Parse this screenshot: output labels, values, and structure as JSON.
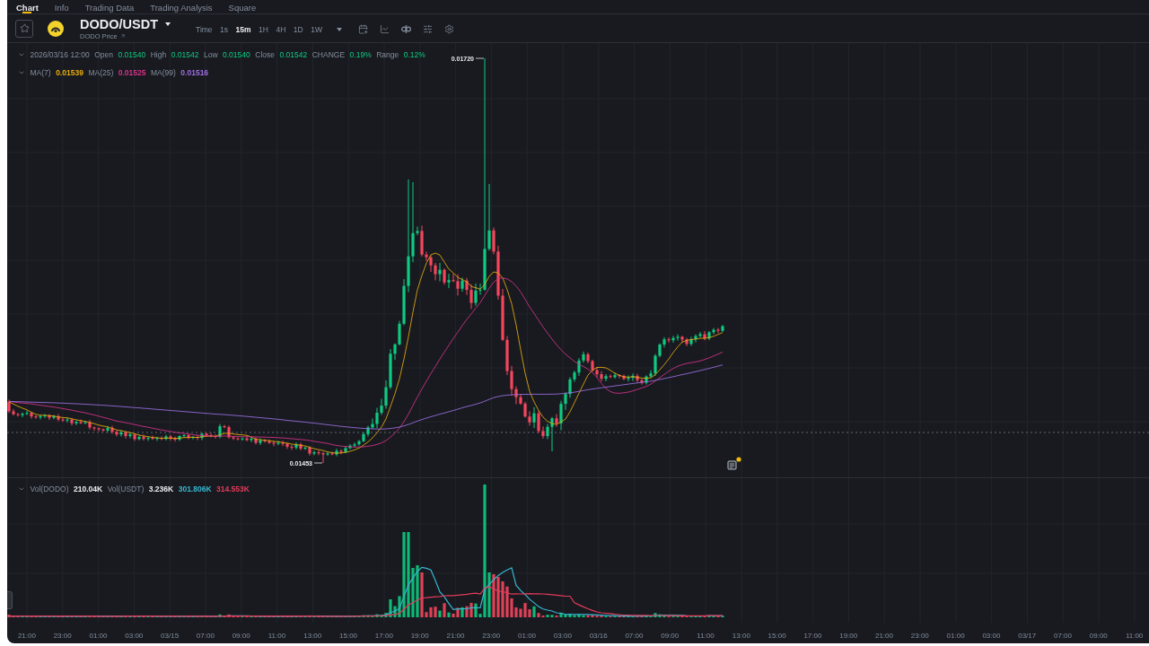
{
  "tabs": [
    {
      "label": "Chart",
      "selected": true
    },
    {
      "label": "Info",
      "selected": false
    },
    {
      "label": "Trading Data",
      "selected": false
    },
    {
      "label": "Trading Analysis",
      "selected": false
    },
    {
      "label": "Square",
      "selected": false
    }
  ],
  "symbol": {
    "pair": "DODO/USDT",
    "subtitle": "DODO Price"
  },
  "intervals": [
    {
      "label": "Time",
      "selected": false
    },
    {
      "label": "1s",
      "selected": false
    },
    {
      "label": "15m",
      "selected": true
    },
    {
      "label": "1H",
      "selected": false
    },
    {
      "label": "4H",
      "selected": false
    },
    {
      "label": "1D",
      "selected": false
    },
    {
      "label": "1W",
      "selected": false
    }
  ],
  "ohlc_legend": {
    "datetime": "2026/03/16 12:00",
    "rising": true,
    "fields": [
      {
        "label": "Open",
        "value": "0.01540"
      },
      {
        "label": "High",
        "value": "0.01542"
      },
      {
        "label": "Low",
        "value": "0.01540"
      },
      {
        "label": "Close",
        "value": "0.01542"
      },
      {
        "label": "CHANGE",
        "value": "0.19%"
      },
      {
        "label": "Range",
        "value": "0.12%"
      }
    ]
  },
  "ma_legend": [
    {
      "label": "MA(7)",
      "value": "0.01539",
      "color": "#e8ac0c"
    },
    {
      "label": "MA(25)",
      "value": "0.01525",
      "color": "#d6338a"
    },
    {
      "label": "MA(99)",
      "value": "0.01516",
      "color": "#9d6ee0"
    }
  ],
  "price_chart": {
    "high_label": "0.01720",
    "low_label": "0.01453"
  },
  "volume_legend": [
    {
      "label": "Vol(DODO)",
      "values": [
        {
          "text": "210.04K",
          "color": "#eaecef"
        }
      ]
    },
    {
      "label": "Vol(USDT)",
      "values": [
        {
          "text": "3.236K",
          "color": "#eaecef"
        },
        {
          "text": "301.806K",
          "color": "#38b6d0"
        },
        {
          "text": "314.553K",
          "color": "#e23b5a"
        }
      ]
    }
  ],
  "time_axis": [
    "21:00",
    "23:00",
    "01:00",
    "03:00",
    "03/15",
    "07:00",
    "09:00",
    "11:00",
    "13:00",
    "15:00",
    "17:00",
    "19:00",
    "21:00",
    "23:00",
    "01:00",
    "03:00",
    "03/16",
    "07:00",
    "09:00",
    "11:00",
    "13:00",
    "15:00",
    "17:00",
    "19:00",
    "21:00",
    "23:00",
    "01:00",
    "03:00",
    "03/17",
    "07:00",
    "09:00",
    "11:00"
  ]
}
